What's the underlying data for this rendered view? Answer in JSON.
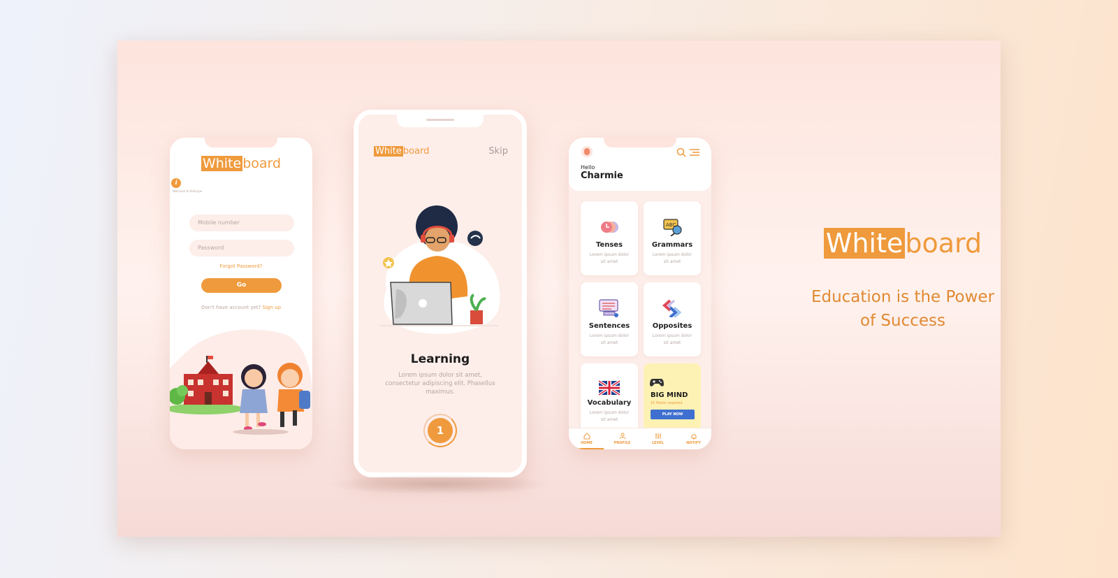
{
  "brand": {
    "highlight": "White",
    "rest": "board",
    "accent": "#ef9a3c"
  },
  "login": {
    "info_text": "Welcome to Kidstype",
    "mobile_placeholder": "Mobile number",
    "password_placeholder": "Password",
    "forgot": "Forgot Password?",
    "go": "Go",
    "no_account": "Don't have account yet?",
    "signup": "Sign up"
  },
  "onboarding": {
    "skip": "Skip",
    "title": "Learning",
    "body": "Lorem ipsum dolor sit amet, consectetur adipiscing elit. Phasellus maximus.",
    "step": "1"
  },
  "home": {
    "greeting": "Hello",
    "name": "Charmie",
    "tiles": [
      {
        "title": "Tenses",
        "sub": "Lorem ipsum dolor sit amet"
      },
      {
        "title": "Grammars",
        "sub": "Lorem ipsum dolor sit amet"
      },
      {
        "title": "Sentences",
        "sub": "Lorem ipsum dolor sit amet"
      },
      {
        "title": "Opposites",
        "sub": "Lorem ipsum dolor sit amet"
      },
      {
        "title": "Vocabulary",
        "sub": "Lorem ipsum dolor sit amet"
      }
    ],
    "bigmind": {
      "title": "BIG MIND",
      "sub": "15 Points required",
      "button": "PLAY NOW"
    },
    "nav": [
      "HOME",
      "PROFILE",
      "LEVEL",
      "NOTIFY"
    ]
  },
  "hero": {
    "tagline_1": "Education is the Power",
    "tagline_2": "of Success"
  }
}
